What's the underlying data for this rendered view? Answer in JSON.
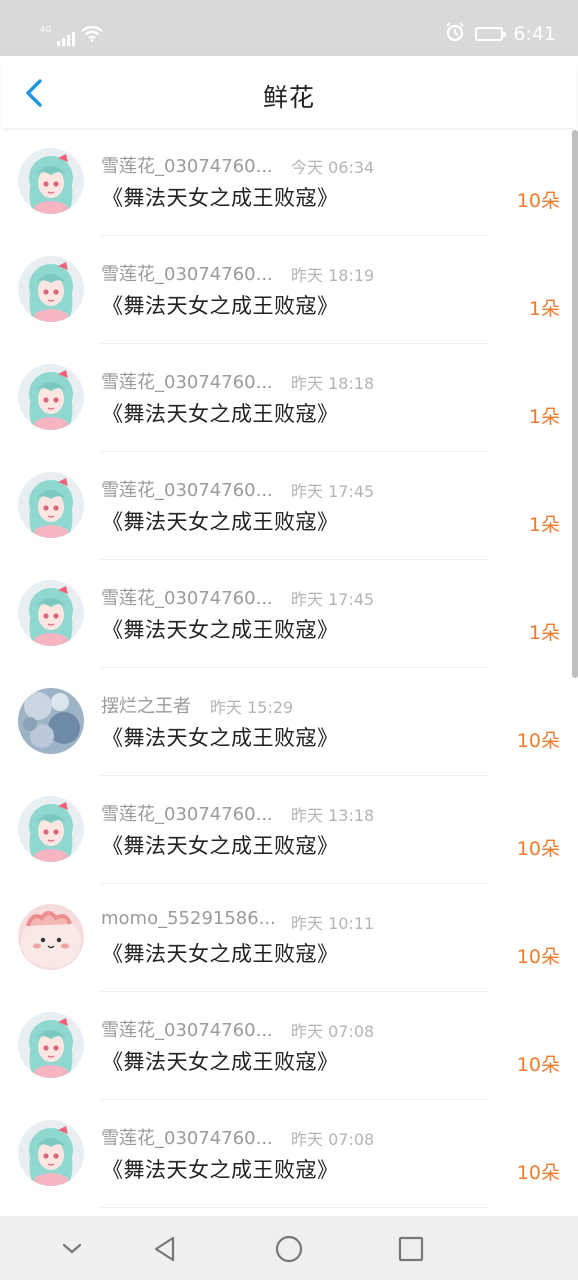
{
  "status_bar": {
    "network": "4G",
    "time": "6:41",
    "icons": [
      "signal-icon",
      "wifi-icon",
      "alarm-icon",
      "battery-icon"
    ]
  },
  "header": {
    "title": "鲜花",
    "back_icon": "chevron-left-icon"
  },
  "colors": {
    "accent_back": "#1f95e6",
    "amount": "#ee7a2c",
    "status_bar_bg": "#d9d9d9"
  },
  "rows": [
    {
      "name": "雪莲花_03074760...",
      "time": "今天 06:34",
      "book": "《舞法天女之成王败寇》",
      "amount": "10朵",
      "avatar": "anime-girl"
    },
    {
      "name": "雪莲花_03074760...",
      "time": "昨天 18:19",
      "book": "《舞法天女之成王败寇》",
      "amount": "1朵",
      "avatar": "anime-girl"
    },
    {
      "name": "雪莲花_03074760...",
      "time": "昨天 18:18",
      "book": "《舞法天女之成王败寇》",
      "amount": "1朵",
      "avatar": "anime-girl"
    },
    {
      "name": "雪莲花_03074760...",
      "time": "昨天 17:45",
      "book": "《舞法天女之成王败寇》",
      "amount": "1朵",
      "avatar": "anime-girl"
    },
    {
      "name": "雪莲花_03074760...",
      "time": "昨天 17:45",
      "book": "《舞法天女之成王败寇》",
      "amount": "1朵",
      "avatar": "anime-girl"
    },
    {
      "name": "摆烂之王者",
      "time": "昨天 15:29",
      "book": "《舞法天女之成王败寇》",
      "amount": "10朵",
      "avatar": "blue-crystal"
    },
    {
      "name": "雪莲花_03074760...",
      "time": "昨天 13:18",
      "book": "《舞法天女之成王败寇》",
      "amount": "10朵",
      "avatar": "anime-girl"
    },
    {
      "name": "momo_55291586...",
      "time": "昨天 10:11",
      "book": "《舞法天女之成王败寇》",
      "amount": "10朵",
      "avatar": "pink-blob"
    },
    {
      "name": "雪莲花_03074760...",
      "time": "昨天 07:08",
      "book": "《舞法天女之成王败寇》",
      "amount": "10朵",
      "avatar": "anime-girl"
    },
    {
      "name": "雪莲花_03074760...",
      "time": "昨天 07:08",
      "book": "《舞法天女之成王败寇》",
      "amount": "10朵",
      "avatar": "anime-girl"
    }
  ],
  "nav_bar": {
    "buttons": [
      "collapse-icon",
      "back-triangle-icon",
      "home-circle-icon",
      "recents-square-icon"
    ]
  }
}
